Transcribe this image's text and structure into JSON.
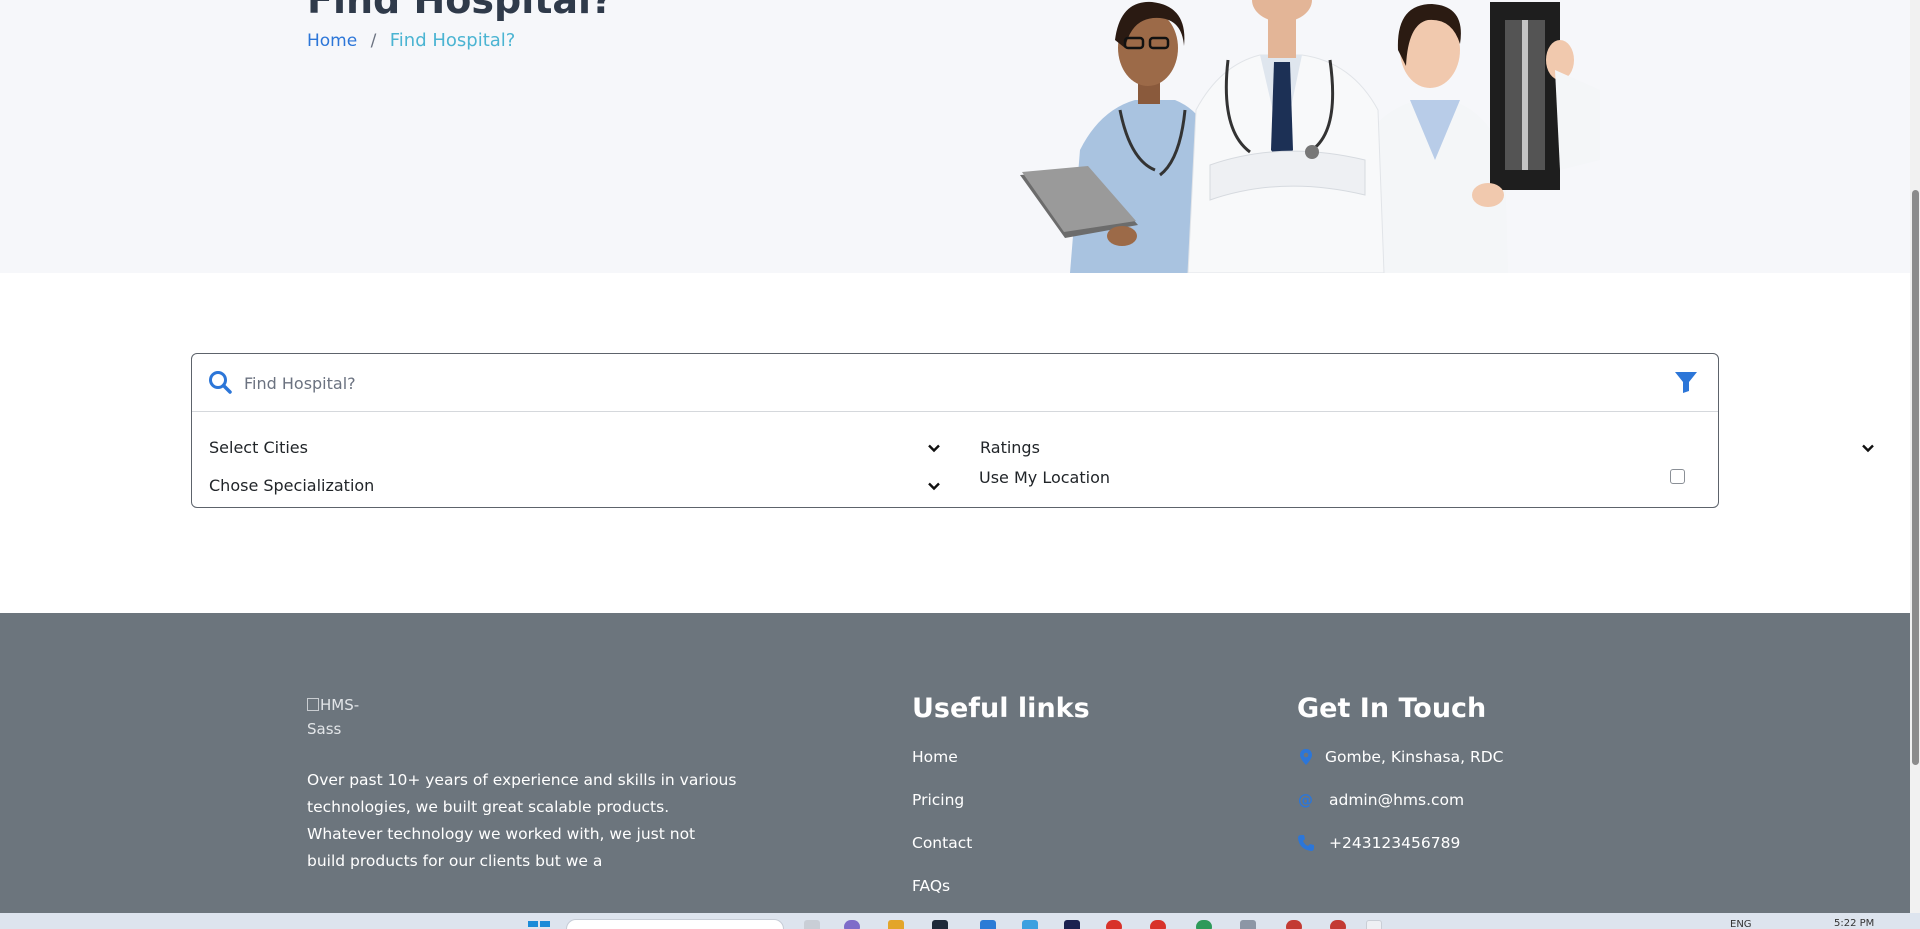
{
  "hero": {
    "title": "Find Hospital?",
    "breadcrumb": {
      "home": "Home",
      "separator": "/",
      "current": "Find Hospital?"
    }
  },
  "search": {
    "placeholder": "Find Hospital?",
    "cities_label": "Select Cities",
    "specialization_label": "Chose Specialization",
    "ratings_label": "Ratings",
    "location_label": "Use My Location",
    "location_checked": false
  },
  "footer": {
    "logo_alt": "HMS-Sass",
    "logo_alt_line1": "HMS-",
    "logo_alt_line2": "Sass",
    "about": "Over past 10+ years of experience and skills in various technologies, we built great scalable products. Whatever technology we worked with, we just not build products for our clients but we a",
    "useful_links_title": "Useful links",
    "links": [
      "Home",
      "Pricing",
      "Contact",
      "FAQs"
    ],
    "get_in_touch_title": "Get In Touch",
    "address": "Gombe, Kinshasa, RDC",
    "email": "admin@hms.com",
    "phone": "+243123456789"
  },
  "icons": {
    "search": "search-icon",
    "filter": "filter-icon",
    "chevron": "chevron-down-icon",
    "address": "map-marker-icon",
    "email": "at-icon",
    "phone": "phone-icon"
  },
  "colors": {
    "accent": "#2c76d8",
    "breadcrumb_current": "#4bb4d2",
    "hero_bg": "#f6f7fa",
    "footer_bg": "#6c757d"
  },
  "taskbar": {
    "language": "ENG",
    "time": "5:22 PM"
  }
}
